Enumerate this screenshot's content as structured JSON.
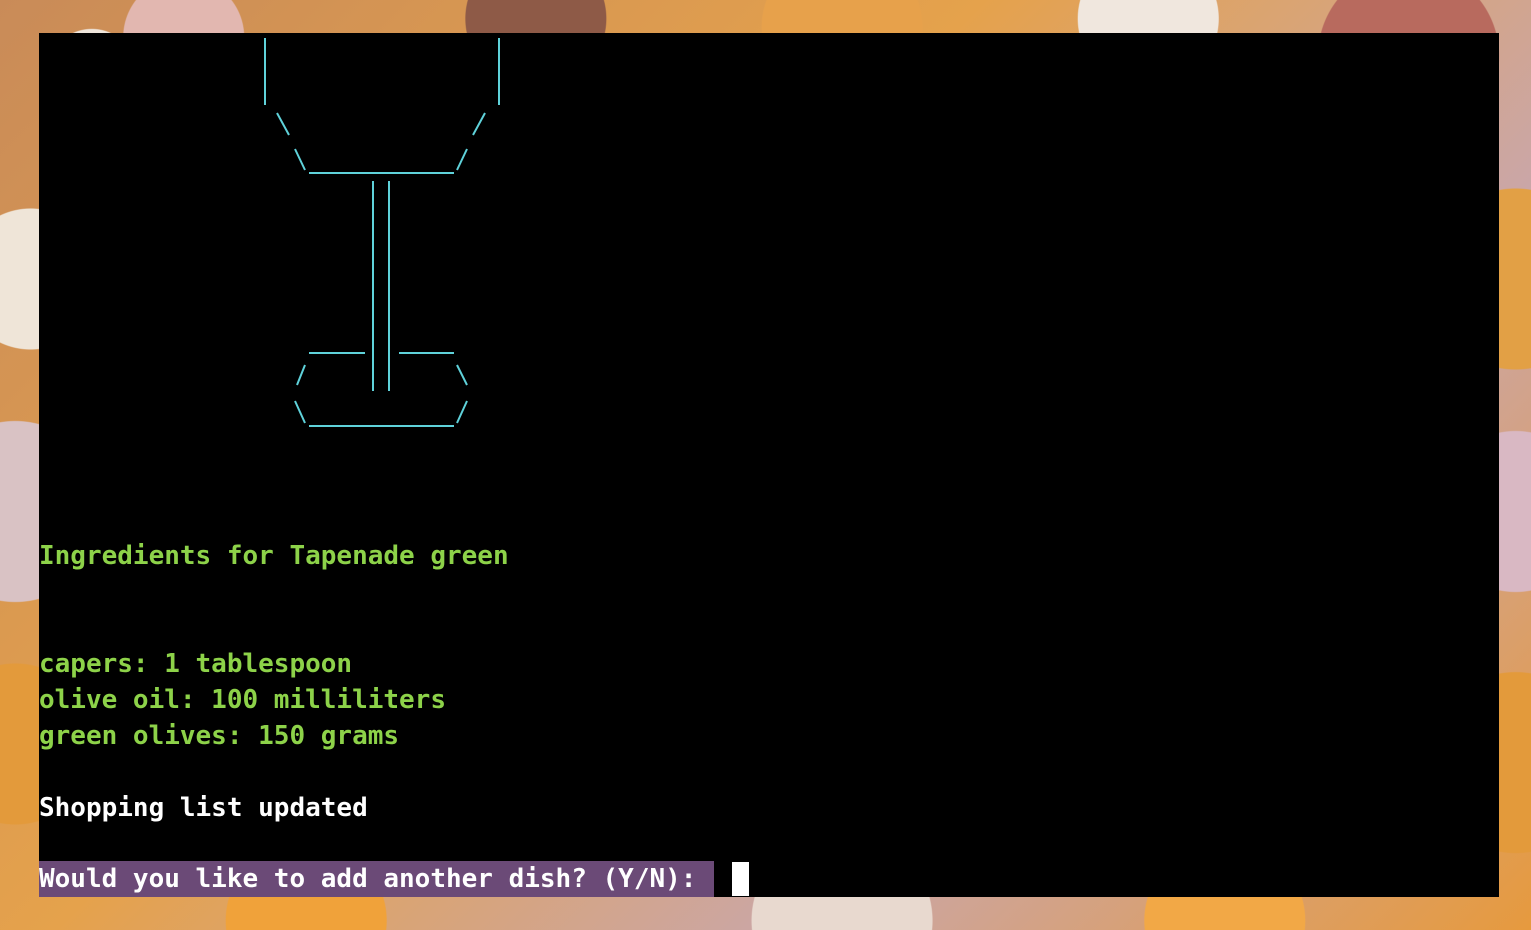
{
  "terminal": {
    "recipe_heading": "Ingredients for Tapenade green",
    "ingredients": [
      "capers: 1 tablespoon",
      "olive oil: 100 milliliters",
      "green olives: 150 grams"
    ],
    "status_message": "Shopping list updated",
    "prompt": "Would you like to add another dish? (Y/N): "
  },
  "colors": {
    "ascii_art": "#5fd2da",
    "text_green": "#8dd249",
    "prompt_bg": "#6b4a77",
    "terminal_bg": "#000000"
  },
  "icons": {
    "ascii_art": "wine-glass-ascii-art"
  }
}
